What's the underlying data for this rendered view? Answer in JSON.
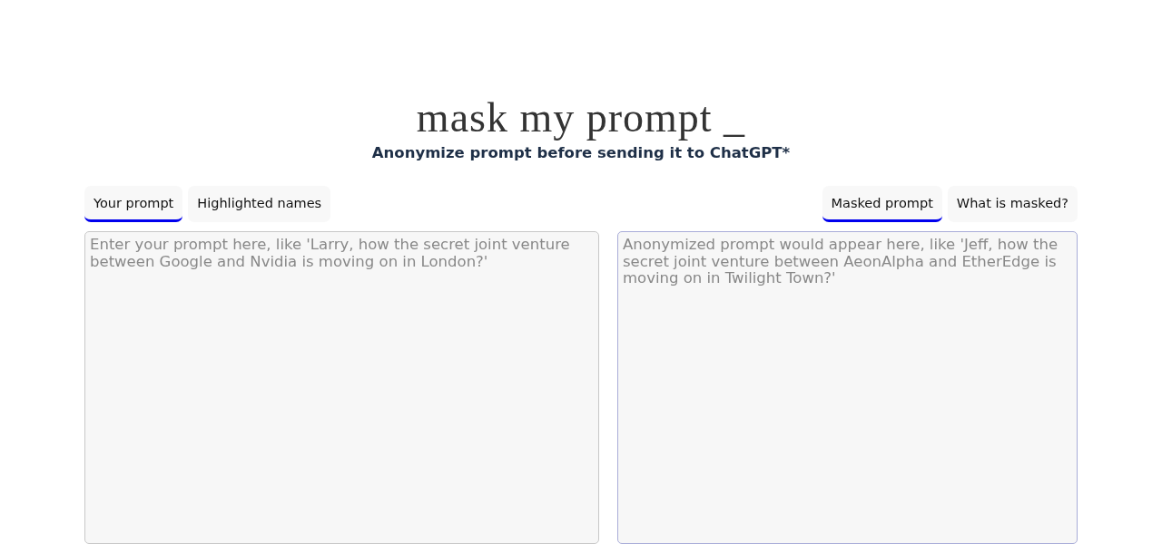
{
  "title": "mask my prompt _",
  "subtitle": "Anonymize prompt before sending it to ChatGPT*",
  "panels": [
    {
      "tabs": [
        {
          "label": "Your prompt",
          "selected": true
        },
        {
          "label": "Highlighted names",
          "selected": false
        }
      ],
      "textarea": {
        "placeholder": "Enter your prompt here, like 'Larry, how the secret joint venture between Google and Nvidia is moving on in London?'",
        "focused": false
      }
    },
    {
      "tabs": [
        {
          "label": "Masked prompt",
          "selected": true
        },
        {
          "label": "What is masked?",
          "selected": false
        }
      ],
      "textarea": {
        "placeholder": "Anonymized prompt would appear here, like 'Jeff, how the secret joint venture between AeonAlpha and EtherEdge is moving on in Twilight Town?'",
        "focused": true
      }
    }
  ]
}
